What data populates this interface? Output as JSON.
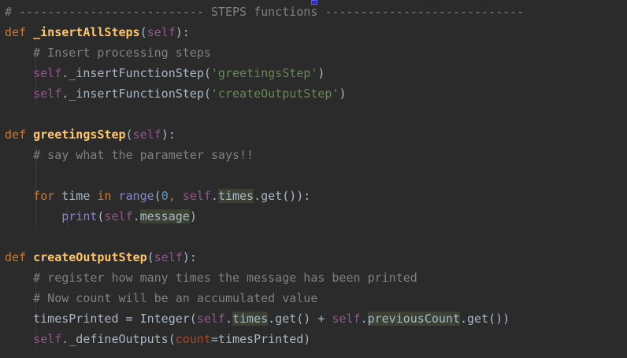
{
  "editor": {
    "language": "python",
    "lines": [
      [
        {
          "t": "# -------------------------- STEPS functions ----------------------------",
          "c": "cm"
        }
      ],
      [
        {
          "t": "def ",
          "c": "kw"
        },
        {
          "t": "_insertAllSteps",
          "c": "fn"
        },
        {
          "t": "(",
          "c": ""
        },
        {
          "t": "self",
          "c": "self"
        },
        {
          "t": "):",
          "c": ""
        }
      ],
      [
        {
          "t": "    ",
          "c": ""
        },
        {
          "t": "# Insert processing steps",
          "c": "cm"
        }
      ],
      [
        {
          "t": "    ",
          "c": ""
        },
        {
          "t": "self",
          "c": "self"
        },
        {
          "t": "._insertFunctionStep(",
          "c": ""
        },
        {
          "t": "'greetingsStep'",
          "c": "str"
        },
        {
          "t": ")",
          "c": ""
        }
      ],
      [
        {
          "t": "    ",
          "c": ""
        },
        {
          "t": "self",
          "c": "self"
        },
        {
          "t": "._insertFunctionStep(",
          "c": ""
        },
        {
          "t": "'createOutputStep'",
          "c": "str"
        },
        {
          "t": ")",
          "c": ""
        }
      ],
      [],
      [
        {
          "t": "def ",
          "c": "kw"
        },
        {
          "t": "greetingsStep",
          "c": "fn"
        },
        {
          "t": "(",
          "c": ""
        },
        {
          "t": "self",
          "c": "self"
        },
        {
          "t": "):",
          "c": ""
        }
      ],
      [
        {
          "t": "    ",
          "c": ""
        },
        {
          "t": "# say what the parameter says!!",
          "c": "cm"
        }
      ],
      [],
      [
        {
          "t": "    ",
          "c": ""
        },
        {
          "t": "for ",
          "c": "kw"
        },
        {
          "t": "time ",
          "c": ""
        },
        {
          "t": "in ",
          "c": "kw"
        },
        {
          "t": "range",
          "c": "bi"
        },
        {
          "t": "(",
          "c": ""
        },
        {
          "t": "0",
          "c": "num"
        },
        {
          "t": ", ",
          "c": "kw"
        },
        {
          "t": "self",
          "c": "self"
        },
        {
          "t": ".",
          "c": ""
        },
        {
          "t": "times",
          "c": "hl"
        },
        {
          "t": ".get()):",
          "c": ""
        }
      ],
      [
        {
          "t": "        ",
          "c": ""
        },
        {
          "t": "print",
          "c": "bi"
        },
        {
          "t": "(",
          "c": ""
        },
        {
          "t": "self",
          "c": "self"
        },
        {
          "t": ".",
          "c": ""
        },
        {
          "t": "message",
          "c": "hl"
        },
        {
          "t": ")",
          "c": ""
        }
      ],
      [],
      [
        {
          "t": "def ",
          "c": "kw"
        },
        {
          "t": "createOutputStep",
          "c": "fn"
        },
        {
          "t": "(",
          "c": ""
        },
        {
          "t": "self",
          "c": "self"
        },
        {
          "t": "):",
          "c": ""
        }
      ],
      [
        {
          "t": "    ",
          "c": ""
        },
        {
          "t": "# register how many times the message has been printed",
          "c": "cm"
        }
      ],
      [
        {
          "t": "    ",
          "c": ""
        },
        {
          "t": "# Now count will be an accumulated value",
          "c": "cm"
        }
      ],
      [
        {
          "t": "    ",
          "c": ""
        },
        {
          "t": "timesPrinted = Integer(",
          "c": ""
        },
        {
          "t": "self",
          "c": "self"
        },
        {
          "t": ".",
          "c": ""
        },
        {
          "t": "times",
          "c": "hl"
        },
        {
          "t": ".get() + ",
          "c": ""
        },
        {
          "t": "self",
          "c": "self"
        },
        {
          "t": ".",
          "c": ""
        },
        {
          "t": "previousCount",
          "c": "hl"
        },
        {
          "t": ".get())",
          "c": ""
        }
      ],
      [
        {
          "t": "    ",
          "c": ""
        },
        {
          "t": "self",
          "c": "self"
        },
        {
          "t": "._defineOutputs(",
          "c": ""
        },
        {
          "t": "count",
          "c": "param"
        },
        {
          "t": "=timesPrinted)",
          "c": ""
        }
      ]
    ]
  },
  "colors": {
    "background": "#2b2b2b",
    "keyword": "#cc7832",
    "function": "#ffc66d",
    "self": "#94558d",
    "comment": "#808080",
    "string": "#6a8759",
    "number": "#6897bb",
    "builtin": "#8888c6",
    "param": "#aa4926",
    "highlight": "#3b4233"
  }
}
